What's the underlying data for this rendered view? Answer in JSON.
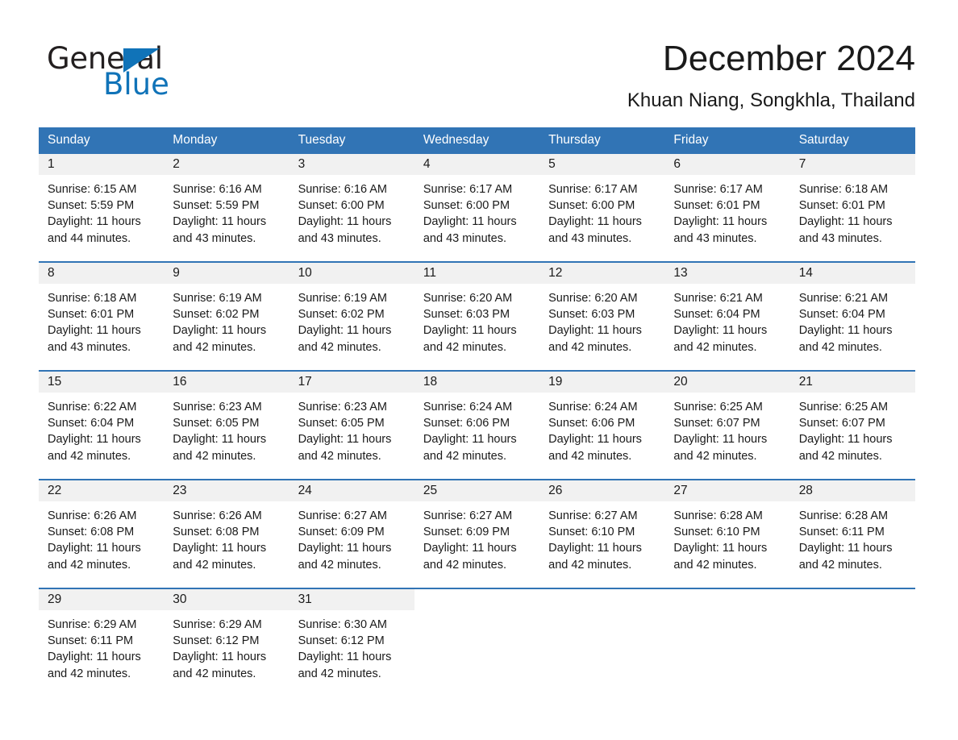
{
  "logo": {
    "word_one": "General",
    "word_two": "Blue"
  },
  "header": {
    "title": "December 2024",
    "subtitle": "Khuan Niang, Songkhla, Thailand"
  },
  "weekdays": [
    "Sunday",
    "Monday",
    "Tuesday",
    "Wednesday",
    "Thursday",
    "Friday",
    "Saturday"
  ],
  "colors": {
    "header_blue": "#3174b5",
    "logo_blue": "#1073b8",
    "day_band_gray": "#f1f1f1",
    "text": "#1a1a1a"
  },
  "weeks": [
    [
      {
        "day": "1",
        "sunrise": "Sunrise: 6:15 AM",
        "sunset": "Sunset: 5:59 PM",
        "daylight_line1": "Daylight: 11 hours",
        "daylight_line2": "and 44 minutes."
      },
      {
        "day": "2",
        "sunrise": "Sunrise: 6:16 AM",
        "sunset": "Sunset: 5:59 PM",
        "daylight_line1": "Daylight: 11 hours",
        "daylight_line2": "and 43 minutes."
      },
      {
        "day": "3",
        "sunrise": "Sunrise: 6:16 AM",
        "sunset": "Sunset: 6:00 PM",
        "daylight_line1": "Daylight: 11 hours",
        "daylight_line2": "and 43 minutes."
      },
      {
        "day": "4",
        "sunrise": "Sunrise: 6:17 AM",
        "sunset": "Sunset: 6:00 PM",
        "daylight_line1": "Daylight: 11 hours",
        "daylight_line2": "and 43 minutes."
      },
      {
        "day": "5",
        "sunrise": "Sunrise: 6:17 AM",
        "sunset": "Sunset: 6:00 PM",
        "daylight_line1": "Daylight: 11 hours",
        "daylight_line2": "and 43 minutes."
      },
      {
        "day": "6",
        "sunrise": "Sunrise: 6:17 AM",
        "sunset": "Sunset: 6:01 PM",
        "daylight_line1": "Daylight: 11 hours",
        "daylight_line2": "and 43 minutes."
      },
      {
        "day": "7",
        "sunrise": "Sunrise: 6:18 AM",
        "sunset": "Sunset: 6:01 PM",
        "daylight_line1": "Daylight: 11 hours",
        "daylight_line2": "and 43 minutes."
      }
    ],
    [
      {
        "day": "8",
        "sunrise": "Sunrise: 6:18 AM",
        "sunset": "Sunset: 6:01 PM",
        "daylight_line1": "Daylight: 11 hours",
        "daylight_line2": "and 43 minutes."
      },
      {
        "day": "9",
        "sunrise": "Sunrise: 6:19 AM",
        "sunset": "Sunset: 6:02 PM",
        "daylight_line1": "Daylight: 11 hours",
        "daylight_line2": "and 42 minutes."
      },
      {
        "day": "10",
        "sunrise": "Sunrise: 6:19 AM",
        "sunset": "Sunset: 6:02 PM",
        "daylight_line1": "Daylight: 11 hours",
        "daylight_line2": "and 42 minutes."
      },
      {
        "day": "11",
        "sunrise": "Sunrise: 6:20 AM",
        "sunset": "Sunset: 6:03 PM",
        "daylight_line1": "Daylight: 11 hours",
        "daylight_line2": "and 42 minutes."
      },
      {
        "day": "12",
        "sunrise": "Sunrise: 6:20 AM",
        "sunset": "Sunset: 6:03 PM",
        "daylight_line1": "Daylight: 11 hours",
        "daylight_line2": "and 42 minutes."
      },
      {
        "day": "13",
        "sunrise": "Sunrise: 6:21 AM",
        "sunset": "Sunset: 6:04 PM",
        "daylight_line1": "Daylight: 11 hours",
        "daylight_line2": "and 42 minutes."
      },
      {
        "day": "14",
        "sunrise": "Sunrise: 6:21 AM",
        "sunset": "Sunset: 6:04 PM",
        "daylight_line1": "Daylight: 11 hours",
        "daylight_line2": "and 42 minutes."
      }
    ],
    [
      {
        "day": "15",
        "sunrise": "Sunrise: 6:22 AM",
        "sunset": "Sunset: 6:04 PM",
        "daylight_line1": "Daylight: 11 hours",
        "daylight_line2": "and 42 minutes."
      },
      {
        "day": "16",
        "sunrise": "Sunrise: 6:23 AM",
        "sunset": "Sunset: 6:05 PM",
        "daylight_line1": "Daylight: 11 hours",
        "daylight_line2": "and 42 minutes."
      },
      {
        "day": "17",
        "sunrise": "Sunrise: 6:23 AM",
        "sunset": "Sunset: 6:05 PM",
        "daylight_line1": "Daylight: 11 hours",
        "daylight_line2": "and 42 minutes."
      },
      {
        "day": "18",
        "sunrise": "Sunrise: 6:24 AM",
        "sunset": "Sunset: 6:06 PM",
        "daylight_line1": "Daylight: 11 hours",
        "daylight_line2": "and 42 minutes."
      },
      {
        "day": "19",
        "sunrise": "Sunrise: 6:24 AM",
        "sunset": "Sunset: 6:06 PM",
        "daylight_line1": "Daylight: 11 hours",
        "daylight_line2": "and 42 minutes."
      },
      {
        "day": "20",
        "sunrise": "Sunrise: 6:25 AM",
        "sunset": "Sunset: 6:07 PM",
        "daylight_line1": "Daylight: 11 hours",
        "daylight_line2": "and 42 minutes."
      },
      {
        "day": "21",
        "sunrise": "Sunrise: 6:25 AM",
        "sunset": "Sunset: 6:07 PM",
        "daylight_line1": "Daylight: 11 hours",
        "daylight_line2": "and 42 minutes."
      }
    ],
    [
      {
        "day": "22",
        "sunrise": "Sunrise: 6:26 AM",
        "sunset": "Sunset: 6:08 PM",
        "daylight_line1": "Daylight: 11 hours",
        "daylight_line2": "and 42 minutes."
      },
      {
        "day": "23",
        "sunrise": "Sunrise: 6:26 AM",
        "sunset": "Sunset: 6:08 PM",
        "daylight_line1": "Daylight: 11 hours",
        "daylight_line2": "and 42 minutes."
      },
      {
        "day": "24",
        "sunrise": "Sunrise: 6:27 AM",
        "sunset": "Sunset: 6:09 PM",
        "daylight_line1": "Daylight: 11 hours",
        "daylight_line2": "and 42 minutes."
      },
      {
        "day": "25",
        "sunrise": "Sunrise: 6:27 AM",
        "sunset": "Sunset: 6:09 PM",
        "daylight_line1": "Daylight: 11 hours",
        "daylight_line2": "and 42 minutes."
      },
      {
        "day": "26",
        "sunrise": "Sunrise: 6:27 AM",
        "sunset": "Sunset: 6:10 PM",
        "daylight_line1": "Daylight: 11 hours",
        "daylight_line2": "and 42 minutes."
      },
      {
        "day": "27",
        "sunrise": "Sunrise: 6:28 AM",
        "sunset": "Sunset: 6:10 PM",
        "daylight_line1": "Daylight: 11 hours",
        "daylight_line2": "and 42 minutes."
      },
      {
        "day": "28",
        "sunrise": "Sunrise: 6:28 AM",
        "sunset": "Sunset: 6:11 PM",
        "daylight_line1": "Daylight: 11 hours",
        "daylight_line2": "and 42 minutes."
      }
    ],
    [
      {
        "day": "29",
        "sunrise": "Sunrise: 6:29 AM",
        "sunset": "Sunset: 6:11 PM",
        "daylight_line1": "Daylight: 11 hours",
        "daylight_line2": "and 42 minutes."
      },
      {
        "day": "30",
        "sunrise": "Sunrise: 6:29 AM",
        "sunset": "Sunset: 6:12 PM",
        "daylight_line1": "Daylight: 11 hours",
        "daylight_line2": "and 42 minutes."
      },
      {
        "day": "31",
        "sunrise": "Sunrise: 6:30 AM",
        "sunset": "Sunset: 6:12 PM",
        "daylight_line1": "Daylight: 11 hours",
        "daylight_line2": "and 42 minutes."
      },
      {
        "day": "",
        "sunrise": "",
        "sunset": "",
        "daylight_line1": "",
        "daylight_line2": ""
      },
      {
        "day": "",
        "sunrise": "",
        "sunset": "",
        "daylight_line1": "",
        "daylight_line2": ""
      },
      {
        "day": "",
        "sunrise": "",
        "sunset": "",
        "daylight_line1": "",
        "daylight_line2": ""
      },
      {
        "day": "",
        "sunrise": "",
        "sunset": "",
        "daylight_line1": "",
        "daylight_line2": ""
      }
    ]
  ]
}
